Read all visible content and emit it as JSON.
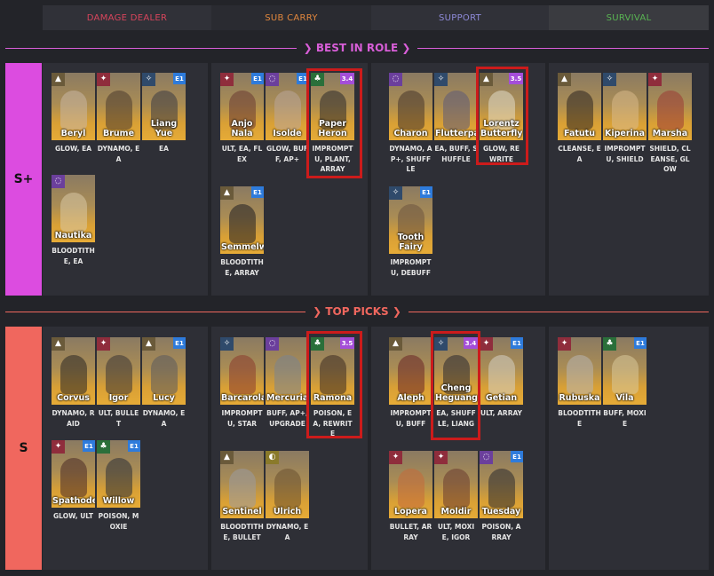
{
  "columns": [
    {
      "label": "DAMAGE DEALER",
      "color": "#d8455c"
    },
    {
      "label": "SUB CARRY",
      "color": "#e2873d"
    },
    {
      "label": "SUPPORT",
      "color": "#8e8ad9"
    },
    {
      "label": "SURVIVAL",
      "color": "#5ab553"
    }
  ],
  "dividers": {
    "best": "BEST IN ROLE",
    "top": "TOP PICKS"
  },
  "tiers": [
    {
      "label": "S+",
      "color": "#dc4ce0"
    },
    {
      "label": "S",
      "color": "#f0675e"
    }
  ],
  "type_colors": {
    "beast": "#8f2d3c",
    "star": "#2f4a6b",
    "mineral": "#6a5a3a",
    "spirit": "#6b3f9c",
    "plant": "#2a6f3a",
    "intellect": "#8a7a2a"
  },
  "type_glyphs": {
    "beast": "✦",
    "star": "✧",
    "mineral": "▲",
    "spirit": "◌",
    "plant": "♣",
    "intellect": "◐"
  },
  "characters": [
    {
      "id": "beryl",
      "name": "Beryl",
      "tags": "GLOW, EA",
      "type": "mineral",
      "badge": "",
      "portrait": "#c9b7a4"
    },
    {
      "id": "brume",
      "name": "Brume",
      "tags": "DYNAMO, EA",
      "type": "beast",
      "badge": "",
      "portrait": "#4a3b2e"
    },
    {
      "id": "liang-yue",
      "name": "Liang Yue",
      "tags": "EA",
      "type": "star",
      "badge": "E1",
      "portrait": "#3a3a44"
    },
    {
      "id": "nautika",
      "name": "Nautika",
      "tags": "BLOODTITHE, EA",
      "type": "spirit",
      "badge": "",
      "portrait": "#d8c9a6"
    },
    {
      "id": "anjo-nala",
      "name": "Anjo Nala",
      "tags": "ULT, EA, FLEX",
      "type": "beast",
      "badge": "E1",
      "portrait": "#6a3b33"
    },
    {
      "id": "isolde",
      "name": "Isolde",
      "tags": "GLOW, BUFF, AP+",
      "type": "spirit",
      "badge": "E1",
      "portrait": "#b9a69a"
    },
    {
      "id": "paper-heron",
      "name": "Paper Heron",
      "tags": "IMPROMPTU, PLANT, ARRAY",
      "type": "plant",
      "badge": "3.4",
      "portrait": "#2b2a2c"
    },
    {
      "id": "semmelweis",
      "name": "Semmelweis",
      "tags": "BLOODTITHE, ARRAY",
      "type": "mineral",
      "badge": "E1",
      "portrait": "#1f1e22"
    },
    {
      "id": "charon",
      "name": "Charon",
      "tags": "DYNAMO, AP+, SHUFFLE",
      "type": "spirit",
      "badge": "",
      "portrait": "#46342c"
    },
    {
      "id": "flutterpage",
      "name": "Flutterpage",
      "tags": "EA, BUFF, SHUFFLE",
      "type": "star",
      "badge": "",
      "portrait": "#5d5a78"
    },
    {
      "id": "lorentz-butterfly",
      "name": "Lorentz Butterfly",
      "tags": "GLOW, REWRITE",
      "type": "mineral",
      "badge": "3.5",
      "portrait": "#e2dccb"
    },
    {
      "id": "tooth-fairy",
      "name": "Tooth Fairy",
      "tags": "IMPROMPTU, DEBUFF",
      "type": "star",
      "badge": "E1",
      "portrait": "#6b5340"
    },
    {
      "id": "fatutu",
      "name": "Fatutu",
      "tags": "CLEANSE, EA",
      "type": "mineral",
      "badge": "",
      "portrait": "#2b2420"
    },
    {
      "id": "kiperina",
      "name": "Kiperina",
      "tags": "IMPROMPTU, SHIELD",
      "type": "star",
      "badge": "",
      "portrait": "#d9b98a"
    },
    {
      "id": "marsha",
      "name": "Marsha",
      "tags": "SHIELD, CLEANSE, GLOW",
      "type": "beast",
      "badge": "",
      "portrait": "#9a3a34"
    },
    {
      "id": "corvus",
      "name": "Corvus",
      "tags": "DYNAMO, RAID",
      "type": "mineral",
      "badge": "",
      "portrait": "#2a2624"
    },
    {
      "id": "igor",
      "name": "Igor",
      "tags": "ULT, BULLET",
      "type": "beast",
      "badge": "",
      "portrait": "#3a3434"
    },
    {
      "id": "lucy",
      "name": "Lucy",
      "tags": "DYNAMO, EA",
      "type": "mineral",
      "badge": "E1",
      "portrait": "#5a5a5e"
    },
    {
      "id": "spathodea",
      "name": "Spathodea",
      "tags": "GLOW, ULT",
      "type": "beast",
      "badge": "E1",
      "portrait": "#4a2a26"
    },
    {
      "id": "willow",
      "name": "Willow",
      "tags": "POISON, MOXIE",
      "type": "plant",
      "badge": "E1",
      "portrait": "#2a2e36"
    },
    {
      "id": "barcarola",
      "name": "Barcarola",
      "tags": "IMPROMPTU, STAR",
      "type": "star",
      "badge": "",
      "portrait": "#8a3a2e"
    },
    {
      "id": "mercuria",
      "name": "Mercuria",
      "tags": "BUFF, AP+, UPGRADE",
      "type": "spirit",
      "badge": "",
      "portrait": "#7a8490"
    },
    {
      "id": "ramona",
      "name": "Ramona",
      "tags": "POISON, EA, REWRITE",
      "type": "plant",
      "badge": "3.5",
      "portrait": "#3a2a22"
    },
    {
      "id": "sentinel",
      "name": "Sentinel",
      "tags": "BLOODTITHE, BULLET",
      "type": "mineral",
      "badge": "",
      "portrait": "#9a9aa0"
    },
    {
      "id": "ulrich",
      "name": "Ulrich",
      "tags": "DYNAMO, EA",
      "type": "intellect",
      "badge": "",
      "portrait": "#6a5030"
    },
    {
      "id": "aleph",
      "name": "Aleph",
      "tags": "IMPROMPTU, BUFF",
      "type": "mineral",
      "badge": "",
      "portrait": "#6a2426"
    },
    {
      "id": "cheng-heguang",
      "name": "Cheng Heguang",
      "tags": "EA, SHUFFLE, LIANG",
      "type": "star",
      "badge": "3.4",
      "portrait": "#2a2830"
    },
    {
      "id": "getian",
      "name": "Getian",
      "tags": "ULT, ARRAY",
      "type": "beast",
      "badge": "E1",
      "portrait": "#d4cfc4"
    },
    {
      "id": "lopera",
      "name": "Lopera",
      "tags": "BULLET, ARRAY",
      "type": "beast",
      "badge": "",
      "portrait": "#c46a3a"
    },
    {
      "id": "moldir",
      "name": "Moldir",
      "tags": "ULT, MOXIE, IGOR",
      "type": "beast",
      "badge": "",
      "portrait": "#6a3a30"
    },
    {
      "id": "tuesday",
      "name": "Tuesday",
      "tags": "POISON, ARRAY",
      "type": "spirit",
      "badge": "E1",
      "portrait": "#2a2a30"
    },
    {
      "id": "rubuska",
      "name": "Rubuska",
      "tags": "BLOODTITHE",
      "type": "beast",
      "badge": "",
      "portrait": "#b8b4b0"
    },
    {
      "id": "vila",
      "name": "Vila",
      "tags": "BUFF, MOXIE",
      "type": "plant",
      "badge": "E1",
      "portrait": "#d8c89a"
    }
  ]
}
